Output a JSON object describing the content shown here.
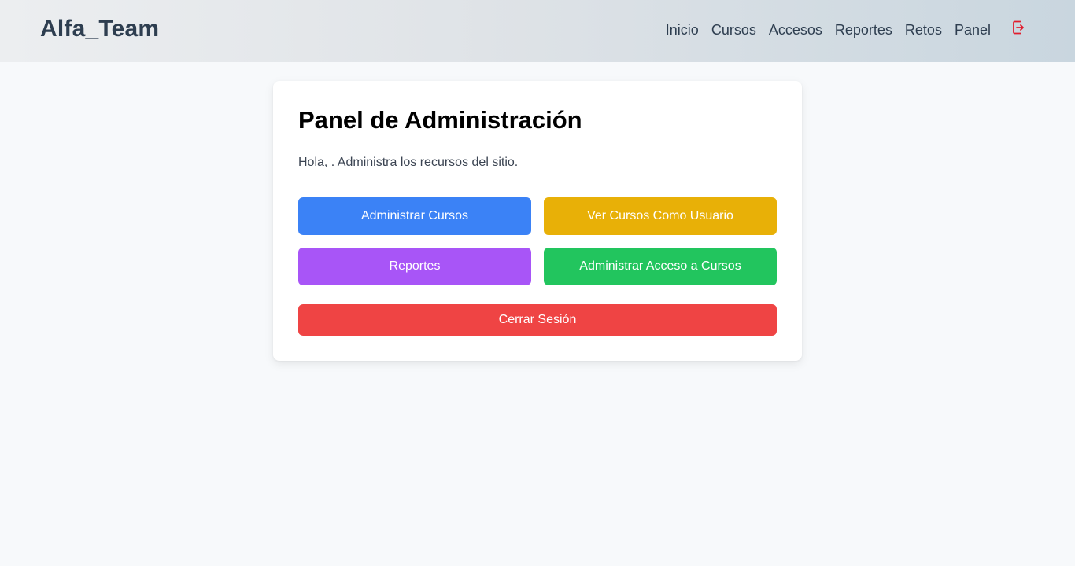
{
  "header": {
    "brand": "Alfa_Team",
    "nav": [
      "Inicio",
      "Cursos",
      "Accesos",
      "Reportes",
      "Retos",
      "Panel"
    ],
    "logout_icon": "logout-icon"
  },
  "panel": {
    "title": "Panel de Administración",
    "greeting": "Hola, . Administra los recursos del sitio.",
    "buttons": {
      "manage_courses": "Administrar Cursos",
      "view_as_user": "Ver Cursos Como Usuario",
      "reports": "Reportes",
      "manage_access": "Administrar Acceso a Cursos",
      "logout": "Cerrar Sesión"
    }
  },
  "colors": {
    "blue": "#3b82f6",
    "yellow": "#e8b007",
    "purple": "#a855f7",
    "green": "#22c55e",
    "red": "#ef4444",
    "icon_red": "#e11d2e"
  }
}
